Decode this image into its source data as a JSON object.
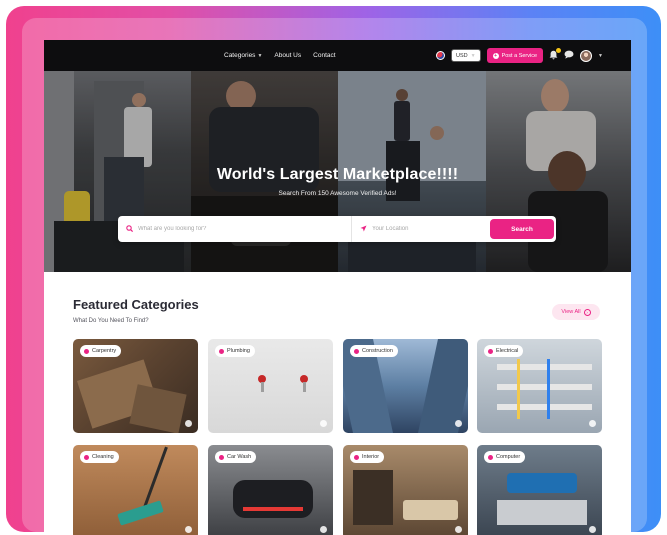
{
  "nav": {
    "links": [
      "Categories",
      "About Us",
      "Contact"
    ],
    "currency": "USD",
    "post_label": "Post a Service"
  },
  "hero": {
    "title": "World's Largest Marketplace!!!!",
    "subtitle": "Search From 150 Awesome Verified Ads!",
    "search_placeholder": "What are you looking for?",
    "location_placeholder": "Your Location",
    "search_label": "Search"
  },
  "featured": {
    "title": "Featured Categories",
    "subtitle": "What Do You Need To Find?",
    "view_all": "View All",
    "categories": [
      {
        "label": "Carpentry"
      },
      {
        "label": "Plumbing"
      },
      {
        "label": "Construction"
      },
      {
        "label": "Electrical"
      },
      {
        "label": "Cleaning"
      },
      {
        "label": "Car Wash"
      },
      {
        "label": "Interior"
      },
      {
        "label": "Computer"
      }
    ]
  },
  "colors": {
    "accent": "#ea2384",
    "nav_bg": "#0d0d0f",
    "frame_left": "#f0418e",
    "frame_right": "#3d8ff7"
  },
  "icons": [
    "chevron-down-icon",
    "flag-icon",
    "plus-icon",
    "bell-icon",
    "chat-icon",
    "avatar",
    "search-icon",
    "location-arrow-icon",
    "arrow-right-icon"
  ]
}
